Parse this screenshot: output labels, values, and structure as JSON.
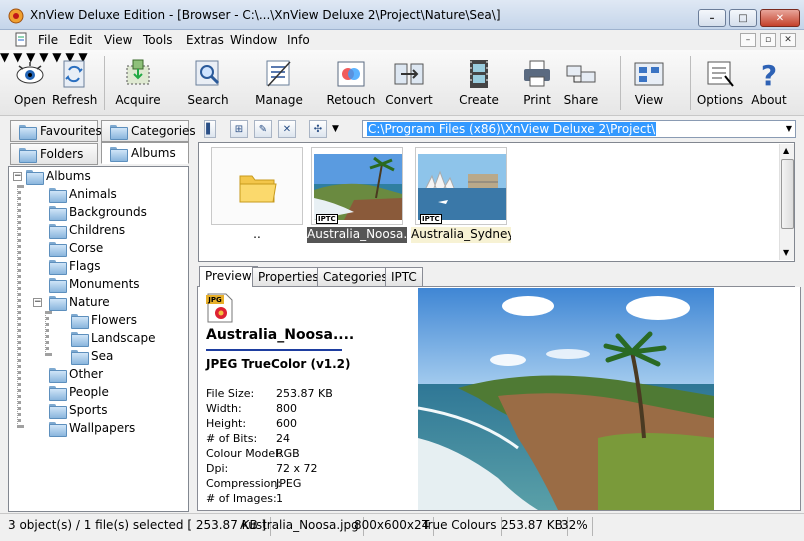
{
  "window": {
    "title": "XnView Deluxe Edition - [Browser - C:\\...\\XnView Deluxe 2\\Project\\Nature\\Sea\\]",
    "min_label": "–",
    "max_label": "□",
    "close_label": "✕"
  },
  "menu": [
    "File",
    "Edit",
    "View",
    "Tools",
    "Extras",
    "Window",
    "Info"
  ],
  "mdi": {
    "min": "–",
    "restore": "▫",
    "close": "✕"
  },
  "toolbar": {
    "open": "Open",
    "refresh": "Refresh",
    "acquire": "Acquire",
    "search": "Search",
    "manage": "Manage",
    "retouch": "Retouch",
    "convert": "Convert",
    "create": "Create",
    "print": "Print",
    "share": "Share",
    "view": "View",
    "options": "Options",
    "about": "About"
  },
  "left_tabs": {
    "favourites": "Favourites",
    "categories": "Categories",
    "folders": "Folders",
    "albums": "Albums"
  },
  "tree": {
    "root": "Albums",
    "items": [
      "Animals",
      "Backgrounds",
      "Childrens",
      "Corse",
      "Flags",
      "Monuments",
      "Nature",
      "Flowers",
      "Landscape",
      "Sea",
      "Other",
      "People",
      "Sports",
      "Wallpapers"
    ]
  },
  "path": "C:\\Program Files (x86)\\XnView Deluxe 2\\Project\\",
  "thumbnails": [
    {
      "label": ".."
    },
    {
      "label": "Australia_Noosa....",
      "badge": "IPTC"
    },
    {
      "label": "Australia_Sydney....",
      "badge": "IPTC"
    }
  ],
  "preview_tabs": [
    "Preview",
    "Properties",
    "Categories",
    "IPTC"
  ],
  "info": {
    "icon_label": "JPG",
    "filename": "Australia_Noosa....",
    "format": "JPEG TrueColor (v1.2)",
    "props": [
      {
        "k": "File Size:",
        "v": "253.87 KB"
      },
      {
        "k": "Width:",
        "v": "800"
      },
      {
        "k": "Height:",
        "v": "600"
      },
      {
        "k": "# of Bits:",
        "v": "24"
      },
      {
        "k": "Colour Model:",
        "v": "RGB"
      },
      {
        "k": "Dpi:",
        "v": "72 x 72"
      },
      {
        "k": "Compression:",
        "v": "JPEG"
      },
      {
        "k": "# of Images:",
        "v": "1"
      }
    ]
  },
  "status": {
    "selection": "3 object(s) / 1 file(s) selected  [ 253.87 KB ]",
    "file": "Australia_Noosa.jpg",
    "dims": "800x600x24",
    "colors": "True Colours",
    "size": "253.87 KB",
    "zoom": "32%"
  }
}
